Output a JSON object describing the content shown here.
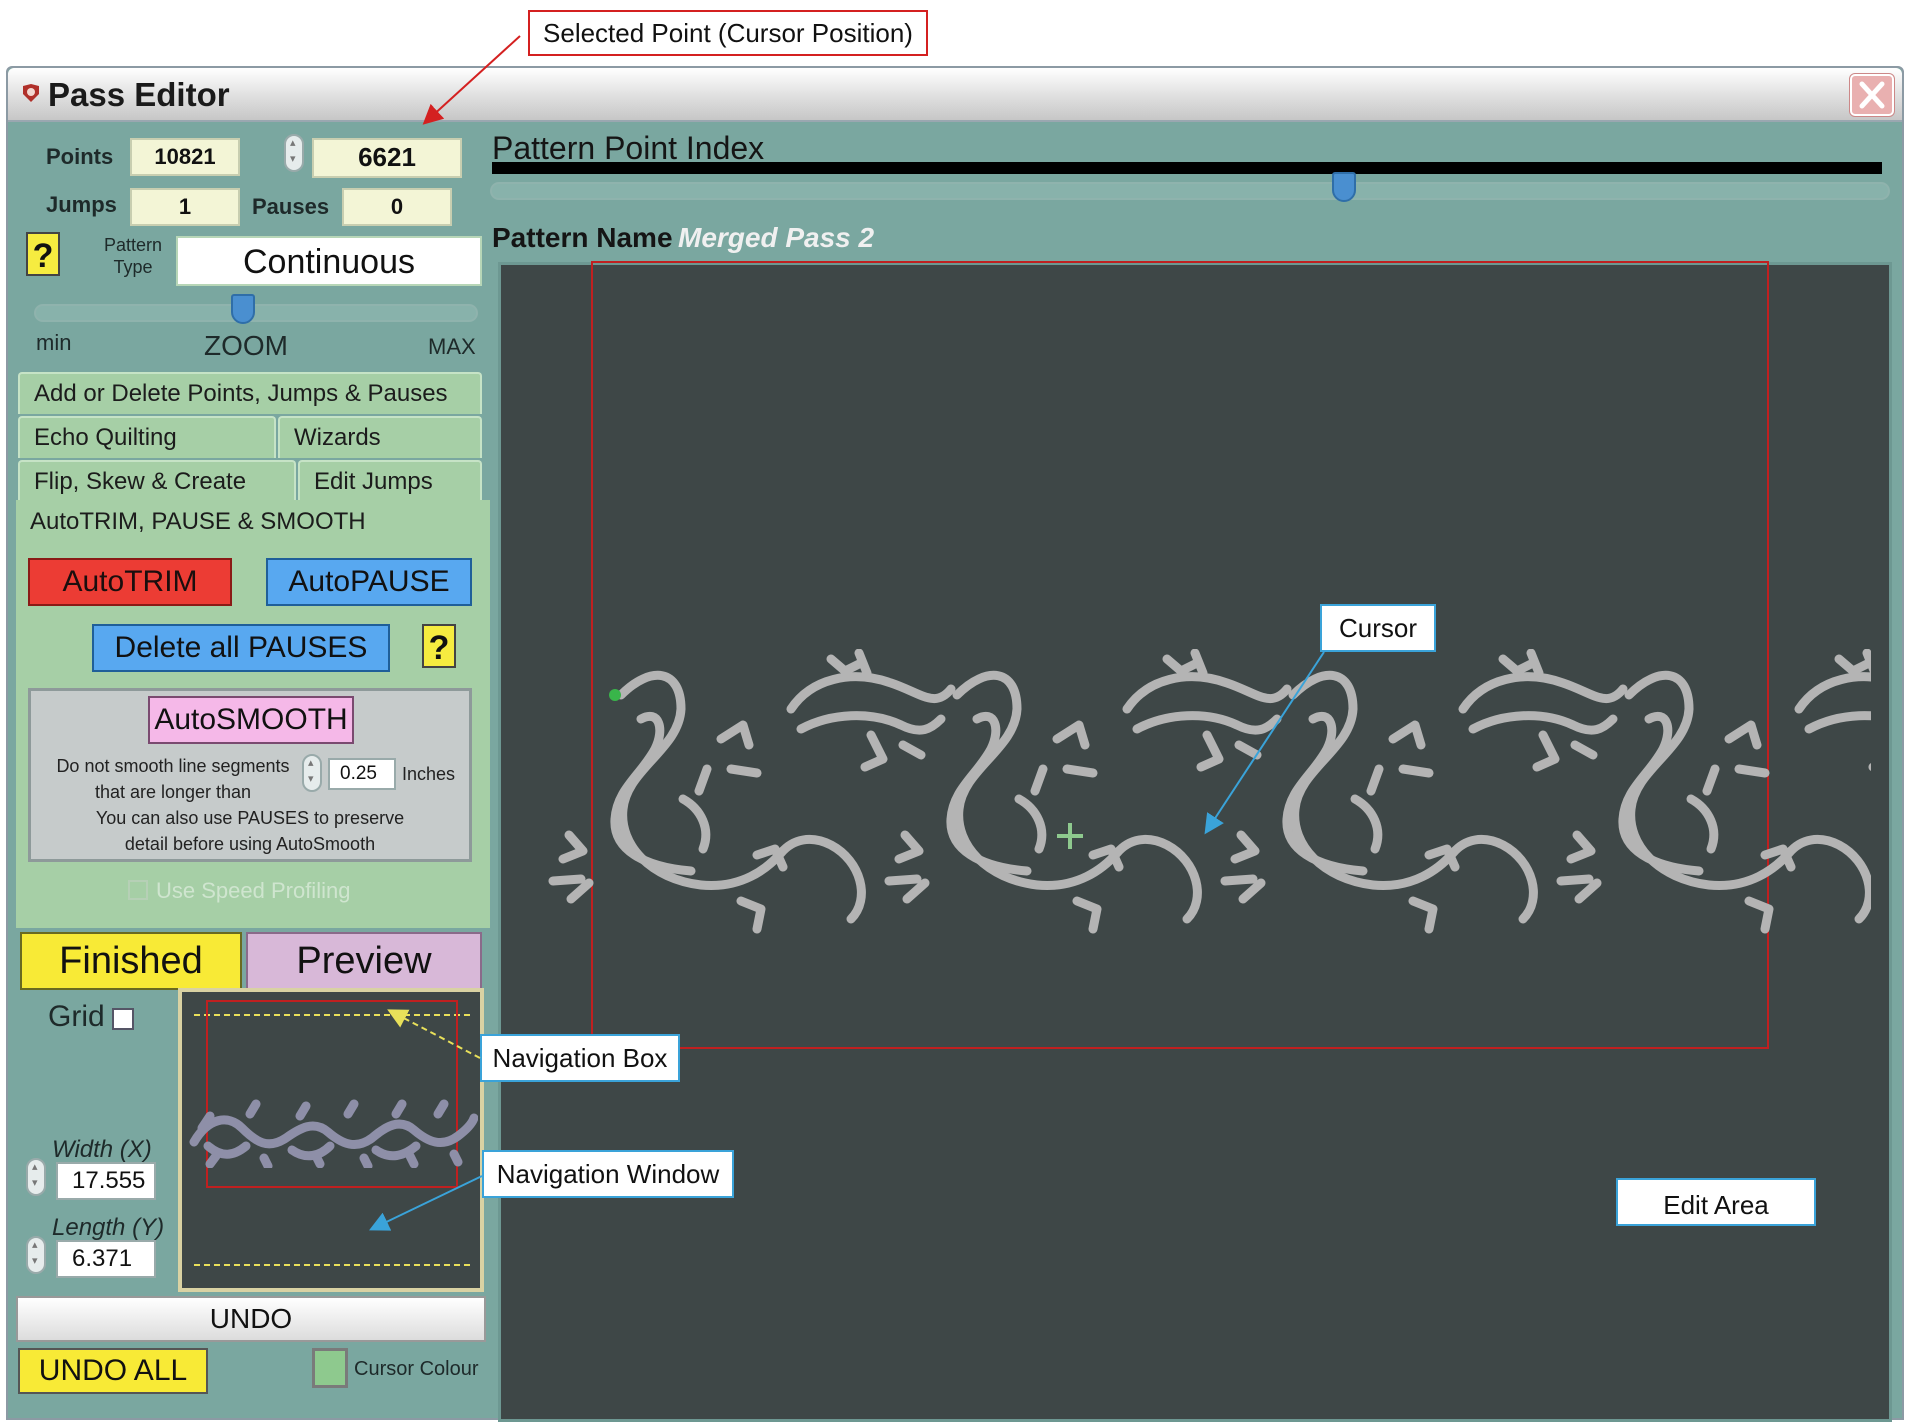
{
  "annotations": {
    "selected_point": "Selected Point (Cursor Position)",
    "cursor": "Cursor",
    "navigation_box": "Navigation Box",
    "navigation_window": "Navigation Window",
    "edit_area": "Edit Area"
  },
  "window": {
    "title": "Pass Editor",
    "close_icon": "close-icon"
  },
  "stats": {
    "points_label": "Points",
    "points_value": "10821",
    "selected_point_value": "6621",
    "jumps_label": "Jumps",
    "jumps_value": "1",
    "pauses_label": "Pauses",
    "pauses_value": "0"
  },
  "pattern_type": {
    "help": "?",
    "label_line1": "Pattern",
    "label_line2": "Type",
    "value": "Continuous"
  },
  "zoom": {
    "min_label": "min",
    "label": "ZOOM",
    "max_label": "MAX",
    "level": 0.47
  },
  "tabs": [
    {
      "label": "Add or Delete Points, Jumps & Pauses"
    },
    {
      "label": "Echo Quilting"
    },
    {
      "label": "Wizards"
    },
    {
      "label": "Flip, Skew & Create"
    },
    {
      "label": "Edit Jumps"
    },
    {
      "label": "AutoTRIM, PAUSE & SMOOTH"
    }
  ],
  "panel": {
    "autotrim": "AutoTRIM",
    "autopause": "AutoPAUSE",
    "delete_pauses": "Delete all PAUSES",
    "help": "?",
    "autosmooth": "AutoSMOOTH",
    "smooth_text_1": "Do not smooth line segments",
    "smooth_text_2": "that are longer than",
    "smooth_value": "0.25",
    "smooth_unit": "Inches",
    "smooth_text_3": "You can also use PAUSES to preserve",
    "smooth_text_4": "detail before using AutoSmooth",
    "speed_profiling": "Use Speed Profiling",
    "speed_profiling_checked": false
  },
  "actions": {
    "finished": "Finished",
    "preview": "Preview"
  },
  "grid": {
    "label": "Grid",
    "checked": false
  },
  "dimensions": {
    "width_label": "Width (X)",
    "width_value": "17.555",
    "length_label": "Length (Y)",
    "length_value": "6.371"
  },
  "undo": {
    "undo": "UNDO",
    "undo_all": "UNDO ALL"
  },
  "cursor_colour": {
    "label": "Cursor Colour",
    "color": "#8ec98e"
  },
  "pattern": {
    "index_label": "Pattern Point Index",
    "index_fraction": 0.61,
    "name_label": "Pattern Name",
    "name_value": "Merged Pass 2"
  },
  "colors": {
    "window_bg": "#7aa7a0",
    "edit_bg": "#3e4747",
    "pattern_stroke": "#b4b4b4",
    "frame_red": "#c02020",
    "start_point": "#39b54a"
  }
}
